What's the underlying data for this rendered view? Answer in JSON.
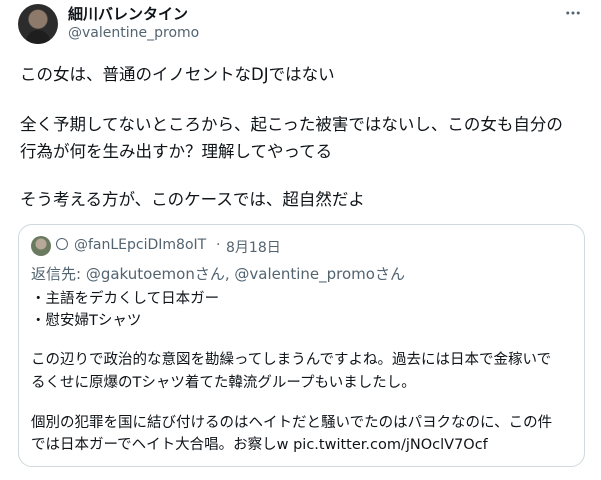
{
  "author": {
    "display_name": "細川バレンタイン",
    "handle": "@valentine_promo",
    "avatar_icon": "user-avatar"
  },
  "more_icon": "more-horizontal-icon",
  "tweet_lines": [
    "この女は、普通のイノセントなDJではない",
    "全く予期してないところから、起こった被害ではないし、この女も自分の",
    "行為が何を生み出すか？理解してやってる",
    "そう考える方が、このケースでは、超自然だよ"
  ],
  "quote": {
    "handle": "@fanLEpciDIm8oIT",
    "separator": "·",
    "date": "8月18日",
    "reply_prefix": "返信先: ",
    "reply_mentions": "@gakutoemonさん, @valentine_promoさん",
    "lines": [
      "・主語をデカくして日本ガー",
      "・慰安婦Tシャツ",
      "この辺りで政治的な意図を勘繰ってしまうんですよね。過去には日本で金稼いで",
      "るくせに原爆のTシャツ着てた韓流グループもいましたし。",
      "個別の犯罪を国に結び付けるのはヘイトだと騒いでたのはパヨクなのに、この件",
      "では日本ガーでヘイト大合唱。お察しw pic.twitter.com/jNOclV7Ocf"
    ]
  }
}
